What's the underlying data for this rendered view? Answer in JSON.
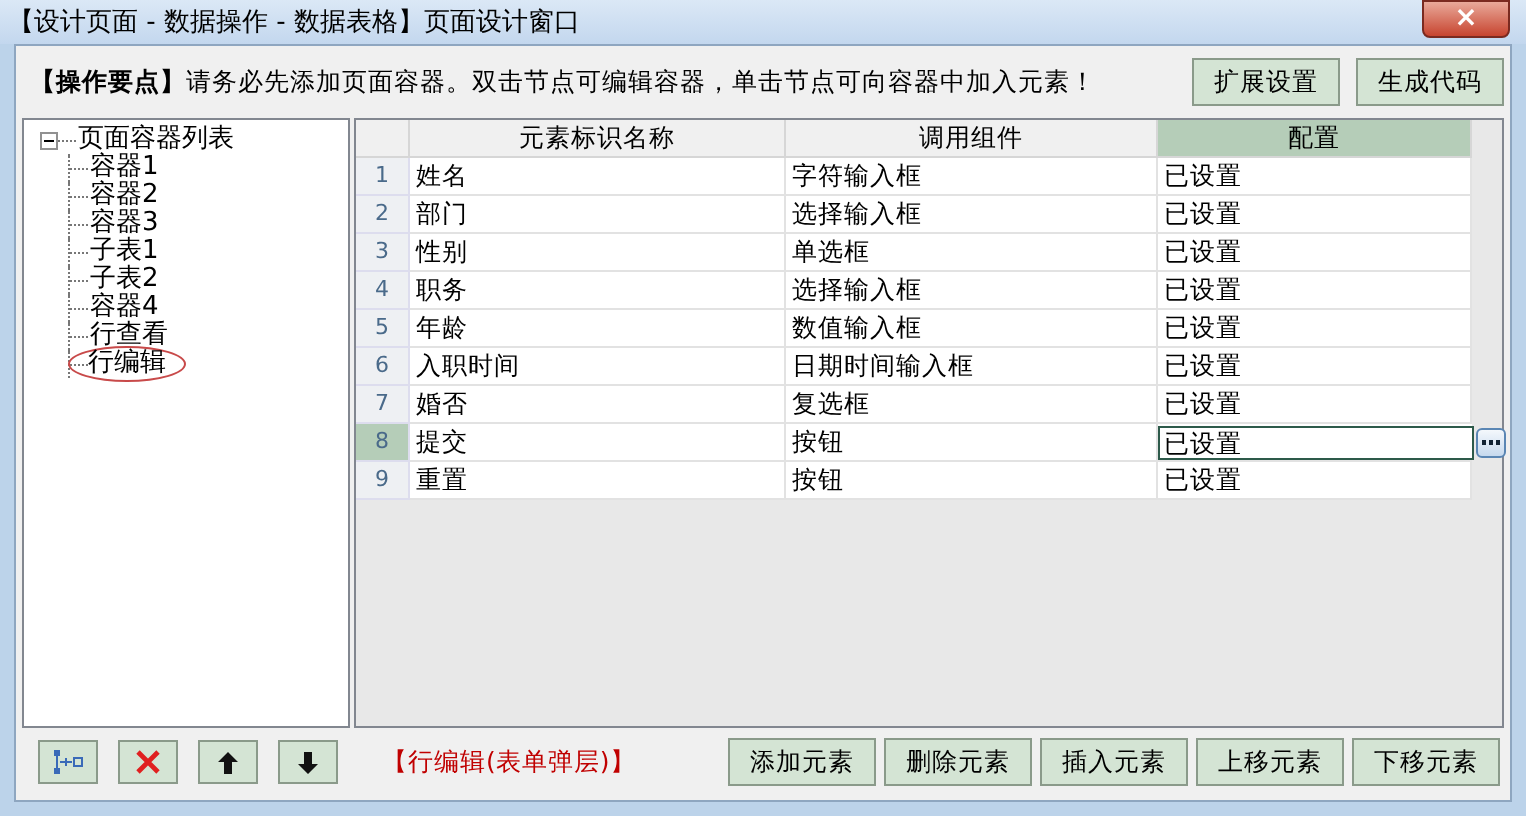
{
  "window": {
    "title": "【设计页面 - 数据操作 - 数据表格】页面设计窗口",
    "close": "×"
  },
  "hint": {
    "label": "【操作要点】",
    "text": "请务必先添加页面容器。双击节点可编辑容器，单击节点可向容器中加入元素！"
  },
  "top_buttons": [
    "扩展设置",
    "生成代码"
  ],
  "tree": {
    "label": "页面容器列表",
    "expanded": true,
    "children": [
      {
        "label": "容器1",
        "selected": false
      },
      {
        "label": "容器2",
        "selected": false
      },
      {
        "label": "容器3",
        "selected": false
      },
      {
        "label": "子表1",
        "selected": false
      },
      {
        "label": "子表2",
        "selected": false
      },
      {
        "label": "容器4",
        "selected": false
      },
      {
        "label": "行查看",
        "selected": false
      },
      {
        "label": "行编辑",
        "selected": true
      }
    ]
  },
  "table": {
    "columns": [
      {
        "label": "元素标识名称",
        "selected": false
      },
      {
        "label": "调用组件",
        "selected": false
      },
      {
        "label": "配置",
        "selected": true
      }
    ],
    "rows": [
      {
        "index": "1",
        "cells": [
          "姓名",
          "字符输入框",
          "已设置"
        ],
        "selected": false
      },
      {
        "index": "2",
        "cells": [
          "部门",
          "选择输入框",
          "已设置"
        ],
        "selected": false
      },
      {
        "index": "3",
        "cells": [
          "性别",
          "单选框",
          "已设置"
        ],
        "selected": false
      },
      {
        "index": "4",
        "cells": [
          "职务",
          "选择输入框",
          "已设置"
        ],
        "selected": false
      },
      {
        "index": "5",
        "cells": [
          "年龄",
          "数值输入框",
          "已设置"
        ],
        "selected": false
      },
      {
        "index": "6",
        "cells": [
          "入职时间",
          "日期时间输入框",
          "已设置"
        ],
        "selected": false
      },
      {
        "index": "7",
        "cells": [
          "婚否",
          "复选框",
          "已设置"
        ],
        "selected": false
      },
      {
        "index": "8",
        "cells": [
          "提交",
          "按钮",
          "已设置"
        ],
        "selected": true
      },
      {
        "index": "9",
        "cells": [
          "重置",
          "按钮",
          "已设置"
        ],
        "selected": false
      }
    ]
  },
  "tree_tools": [
    {
      "kind": "add"
    },
    {
      "kind": "delete"
    },
    {
      "kind": "up"
    },
    {
      "kind": "down"
    }
  ],
  "status": "【行编辑(表单弹层)】",
  "bottom_buttons": [
    "添加元素",
    "删除元素",
    "插入元素",
    "上移元素",
    "下移元素"
  ]
}
